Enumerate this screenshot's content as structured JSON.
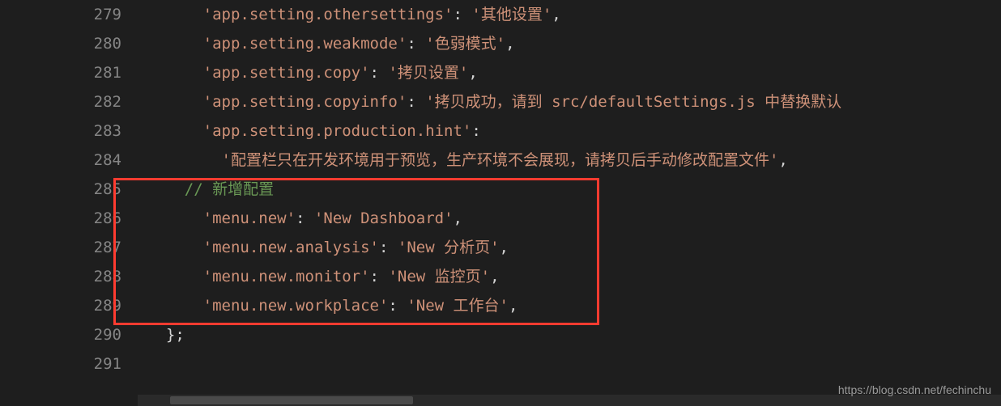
{
  "lines": [
    {
      "num": "279",
      "indent": 3,
      "tokens": [
        {
          "t": "s",
          "v": "'app.setting.othersettings'"
        },
        {
          "t": "p",
          "v": ": "
        },
        {
          "t": "s",
          "v": "'其他设置'"
        },
        {
          "t": "p",
          "v": ","
        }
      ]
    },
    {
      "num": "280",
      "indent": 3,
      "tokens": [
        {
          "t": "s",
          "v": "'app.setting.weakmode'"
        },
        {
          "t": "p",
          "v": ": "
        },
        {
          "t": "s",
          "v": "'色弱模式'"
        },
        {
          "t": "p",
          "v": ","
        }
      ]
    },
    {
      "num": "281",
      "indent": 3,
      "tokens": [
        {
          "t": "s",
          "v": "'app.setting.copy'"
        },
        {
          "t": "p",
          "v": ": "
        },
        {
          "t": "s",
          "v": "'拷贝设置'"
        },
        {
          "t": "p",
          "v": ","
        }
      ]
    },
    {
      "num": "282",
      "indent": 3,
      "tokens": [
        {
          "t": "s",
          "v": "'app.setting.copyinfo'"
        },
        {
          "t": "p",
          "v": ": "
        },
        {
          "t": "s",
          "v": "'拷贝成功，请到 src/defaultSettings.js 中替换默认"
        }
      ]
    },
    {
      "num": "283",
      "indent": 3,
      "tokens": [
        {
          "t": "s",
          "v": "'app.setting.production.hint'"
        },
        {
          "t": "p",
          "v": ":"
        }
      ]
    },
    {
      "num": "284",
      "indent": 4,
      "tokens": [
        {
          "t": "s",
          "v": "'配置栏只在开发环境用于预览，生产环境不会展现，请拷贝后手动修改配置文件'"
        },
        {
          "t": "p",
          "v": ","
        }
      ]
    },
    {
      "num": "285",
      "indent": 2,
      "tokens": [
        {
          "t": "cg",
          "v": "// "
        },
        {
          "t": "c",
          "v": "新增配置"
        }
      ]
    },
    {
      "num": "286",
      "indent": 3,
      "tokens": [
        {
          "t": "s",
          "v": "'menu.new'"
        },
        {
          "t": "p",
          "v": ": "
        },
        {
          "t": "s",
          "v": "'New Dashboard'"
        },
        {
          "t": "p",
          "v": ","
        }
      ]
    },
    {
      "num": "287",
      "indent": 3,
      "tokens": [
        {
          "t": "s",
          "v": "'menu.new.analysis'"
        },
        {
          "t": "p",
          "v": ": "
        },
        {
          "t": "s",
          "v": "'New 分析页'"
        },
        {
          "t": "p",
          "v": ","
        }
      ]
    },
    {
      "num": "288",
      "indent": 3,
      "tokens": [
        {
          "t": "s",
          "v": "'menu.new.monitor'"
        },
        {
          "t": "p",
          "v": ": "
        },
        {
          "t": "s",
          "v": "'New 监控页'"
        },
        {
          "t": "p",
          "v": ","
        }
      ]
    },
    {
      "num": "289",
      "indent": 3,
      "tokens": [
        {
          "t": "s",
          "v": "'menu.new.workplace'"
        },
        {
          "t": "p",
          "v": ": "
        },
        {
          "t": "s",
          "v": "'New 工作台'"
        },
        {
          "t": "p",
          "v": ","
        }
      ]
    },
    {
      "num": "290",
      "indent": 1,
      "tokens": [
        {
          "t": "p",
          "v": "};"
        }
      ]
    },
    {
      "num": "291",
      "indent": 0,
      "tokens": []
    }
  ],
  "watermark": "https://blog.csdn.net/fechinchu"
}
